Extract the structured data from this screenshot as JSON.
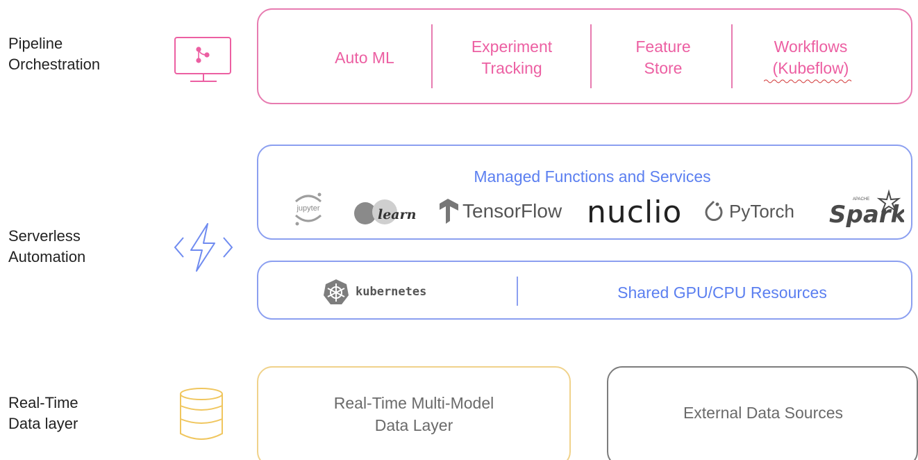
{
  "layers": {
    "pipeline": {
      "label": "Pipeline\nOrchestration",
      "icon": "monitor-pipeline-icon"
    },
    "serverless": {
      "label": "Serverless\nAutomation",
      "icon": "lightning-code-icon"
    },
    "realtime": {
      "label": "Real-Time\nData layer",
      "icon": "database-icon"
    }
  },
  "pipeline_box": {
    "items": [
      {
        "label": "Auto ML"
      },
      {
        "label": "Experiment\nTracking"
      },
      {
        "label": "Feature\nStore"
      },
      {
        "label": "Workflows\n(Kubeflow)"
      }
    ],
    "color": "#e77bb0"
  },
  "managed_box": {
    "title": "Managed Functions and Services",
    "logos": {
      "jupyter": "jupyter",
      "sklearn": "learn",
      "tensorflow": "TensorFlow",
      "nuclio": "nuclio",
      "pytorch": "PyTorch",
      "spark": "Spark",
      "spark_apache": "APACHE"
    },
    "color": "#8b9ff0"
  },
  "resources_box": {
    "kubernetes": "kubernetes",
    "shared": "Shared GPU/CPU Resources"
  },
  "data_boxes": {
    "multi_model": "Real-Time Multi-Model\nData Layer",
    "external": "External Data Sources"
  },
  "colors": {
    "pink": "#ec5fa2",
    "blue": "#5b7ff0",
    "gold": "#f0d28a",
    "gray": "#7c7c7c"
  }
}
